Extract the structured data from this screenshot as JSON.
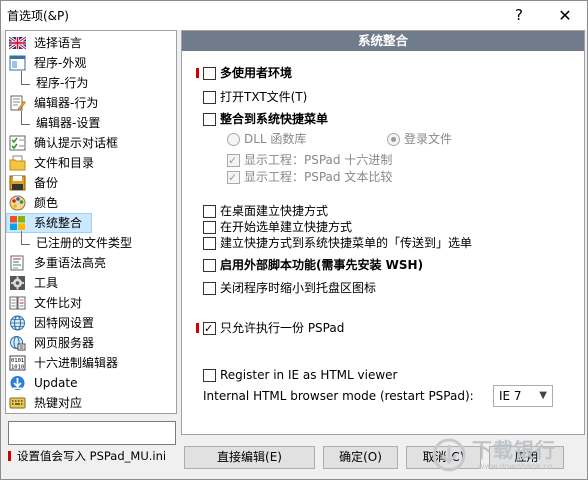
{
  "window": {
    "title": "首选项(&P)",
    "help_glyph": "?",
    "close_glyph": "✕"
  },
  "sidebar": {
    "items": [
      {
        "label": "选择语言",
        "icon": "uk-flag-icon"
      },
      {
        "label": "程序-外观",
        "icon": "window-layout-icon"
      },
      {
        "label": "程序-行为",
        "icon": "",
        "child": true
      },
      {
        "label": "编辑器-行为",
        "icon": "document-edit-icon"
      },
      {
        "label": "编辑器-设置",
        "icon": "",
        "child": true
      },
      {
        "label": "确认提示对话框",
        "icon": "checklist-icon"
      },
      {
        "label": "文件和目录",
        "icon": "folder-icon"
      },
      {
        "label": "备份",
        "icon": "floppy-disk-icon"
      },
      {
        "label": "颜色",
        "icon": "palette-icon"
      },
      {
        "label": "系统整合",
        "icon": "windows-logo-icon",
        "selected": true
      },
      {
        "label": "已注册的文件类型",
        "icon": "",
        "child": true
      },
      {
        "label": "多重语法高亮",
        "icon": "syntax-icon"
      },
      {
        "label": "工具",
        "icon": "gear-icon"
      },
      {
        "label": "文件比对",
        "icon": "compare-icon"
      },
      {
        "label": "因特网设置",
        "icon": "globe-icon"
      },
      {
        "label": "网页服务器",
        "icon": "server-icon"
      },
      {
        "label": "十六进制编辑器",
        "icon": "hex-icon"
      },
      {
        "label": "Update",
        "icon": "update-icon"
      },
      {
        "label": "热键对应",
        "icon": "keyboard-icon"
      }
    ],
    "search_value": "",
    "note": "设置值会写入 PSPad_MU.ini"
  },
  "panel": {
    "title": "系统整合",
    "multi_user": "多使用者环境",
    "open_txt": "打开TXT文件(T)",
    "shell_menu": "整合到系统快捷菜单",
    "dll_lib": "DLL 函数库",
    "registry": "登录文件",
    "show_hex": "显示工程：PSPad 十六进制",
    "show_diff": "显示工程：PSPad 文本比较",
    "desktop_shortcut": "在桌面建立快捷方式",
    "start_menu": "在开始选单建立快捷方式",
    "sendto": "建立快捷方式到系统快捷菜单的「传送到」选单",
    "wsh": "启用外部脚本功能(需事先安装 WSH)",
    "tray": "关闭程序时缩小到托盘区图标",
    "single_instance": "只允许执行一份 PSPad",
    "register_ie": "Register in IE as HTML viewer",
    "browser_mode_label": "Internal HTML browser mode (restart PSPad):",
    "browser_mode_value": "IE 7"
  },
  "buttons": {
    "direct_edit": "直接编辑(E)",
    "ok": "确定(O)",
    "cancel": "取消(C)",
    "apply": "应用"
  },
  "watermark": {
    "text": "下载银行",
    "url": "www.downbank.cn"
  },
  "colors": {
    "panel_header": "#707c8c",
    "selection": "#cce8ff",
    "mark": "#d00000"
  }
}
